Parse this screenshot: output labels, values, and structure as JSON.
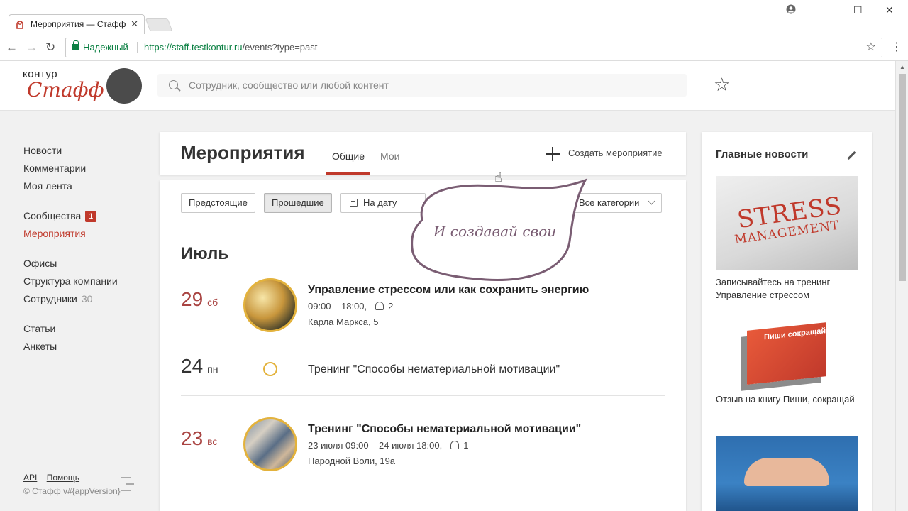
{
  "browser": {
    "tab_title": "Мероприятия — Стафф",
    "secure_label": "Надежный",
    "url_host": "https://staff.testkontur.ru",
    "url_path": "/events?type=past"
  },
  "header": {
    "logo_top": "контур",
    "logo_main": "Стафф",
    "search_placeholder": "Сотрудник, сообщество или любой контент"
  },
  "sidebar": {
    "news": "Новости",
    "comments": "Комментарии",
    "feed": "Моя лента",
    "communities": "Сообщества",
    "communities_badge": "1",
    "events": "Мероприятия",
    "offices": "Офисы",
    "structure": "Структура компании",
    "employees": "Сотрудники",
    "employees_count": "30",
    "articles": "Статьи",
    "surveys": "Анкеты",
    "footer_api": "API",
    "footer_help": "Помощь",
    "copyright": "© Стафф v#{appVersion}"
  },
  "main": {
    "title": "Мероприятия",
    "tab_common": "Общие",
    "tab_mine": "Мои",
    "create_label": "Создать мероприятие",
    "filter_upcoming": "Предстоящие",
    "filter_past": "Прошедшие",
    "filter_date": "На дату",
    "filter_categories": "Все категории",
    "month": "Июль",
    "events": [
      {
        "day": "29",
        "dow": "сб",
        "title": "Управление стрессом или как сохранить энергию",
        "time": "09:00 – 18:00,",
        "participants": "2",
        "address": "Карла Маркса, 5"
      },
      {
        "day": "24",
        "dow": "пн",
        "title": "Тренинг \"Способы нематериальной мотивации\""
      },
      {
        "day": "23",
        "dow": "вс",
        "title": "Тренинг \"Способы нематериальной мотивации\"",
        "time": "23 июля 09:00 – 24 июля 18:00,",
        "participants": "1",
        "address": "Народной Воли, 19а"
      }
    ]
  },
  "callout": {
    "text": "И создавай свои"
  },
  "news": {
    "title": "Главные новости",
    "items": [
      {
        "image_word_1": "STRESS",
        "image_word_2": "MANAGEMENT",
        "caption": "Записывайтесь на тренинг Управление стрессом"
      },
      {
        "image_word": "Пиши сокращай",
        "caption": "Отзыв на книгу Пиши, сокращай"
      }
    ]
  },
  "colors": {
    "accent": "#c0392b",
    "ring": "#e3b23c",
    "callout": "#7a5d73"
  }
}
